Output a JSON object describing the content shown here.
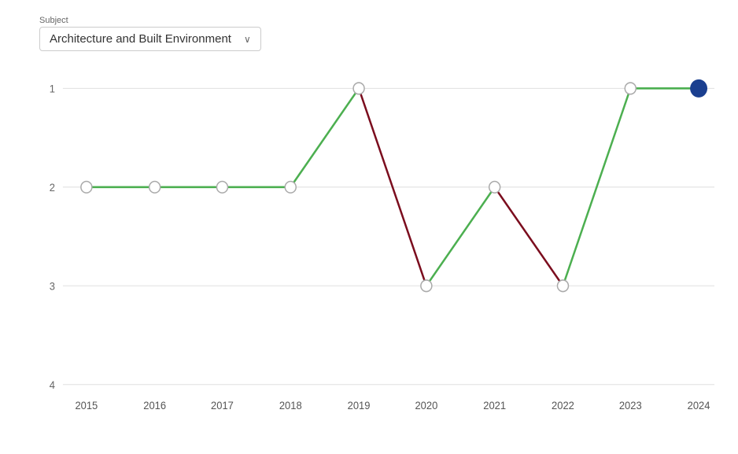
{
  "subject_label": "Subject",
  "dropdown": {
    "value": "Architecture and Built Environment",
    "arrow": "∨"
  },
  "chart": {
    "y_axis": {
      "labels": [
        "1",
        "2",
        "3",
        "4"
      ],
      "values": [
        1,
        2,
        3,
        4
      ]
    },
    "x_axis": {
      "years": [
        "2015",
        "2016",
        "2017",
        "2018",
        "2019",
        "2020",
        "2021",
        "2022",
        "2023",
        "2024"
      ]
    },
    "data_points": [
      {
        "year": "2015",
        "rank": 2
      },
      {
        "year": "2016",
        "rank": 2
      },
      {
        "year": "2017",
        "rank": 2
      },
      {
        "year": "2018",
        "rank": 2
      },
      {
        "year": "2019",
        "rank": 1
      },
      {
        "year": "2020",
        "rank": 3
      },
      {
        "year": "2021",
        "rank": 2
      },
      {
        "year": "2022",
        "rank": 3
      },
      {
        "year": "2023",
        "rank": 1
      },
      {
        "year": "2024",
        "rank": 1
      }
    ],
    "green_color": "#4caf50",
    "red_color": "#7b0d1e",
    "blue_color": "#1a3f8f",
    "circle_fill_open": "#fff",
    "circle_stroke": "#aaa",
    "circle_stroke_green": "#4caf50"
  }
}
